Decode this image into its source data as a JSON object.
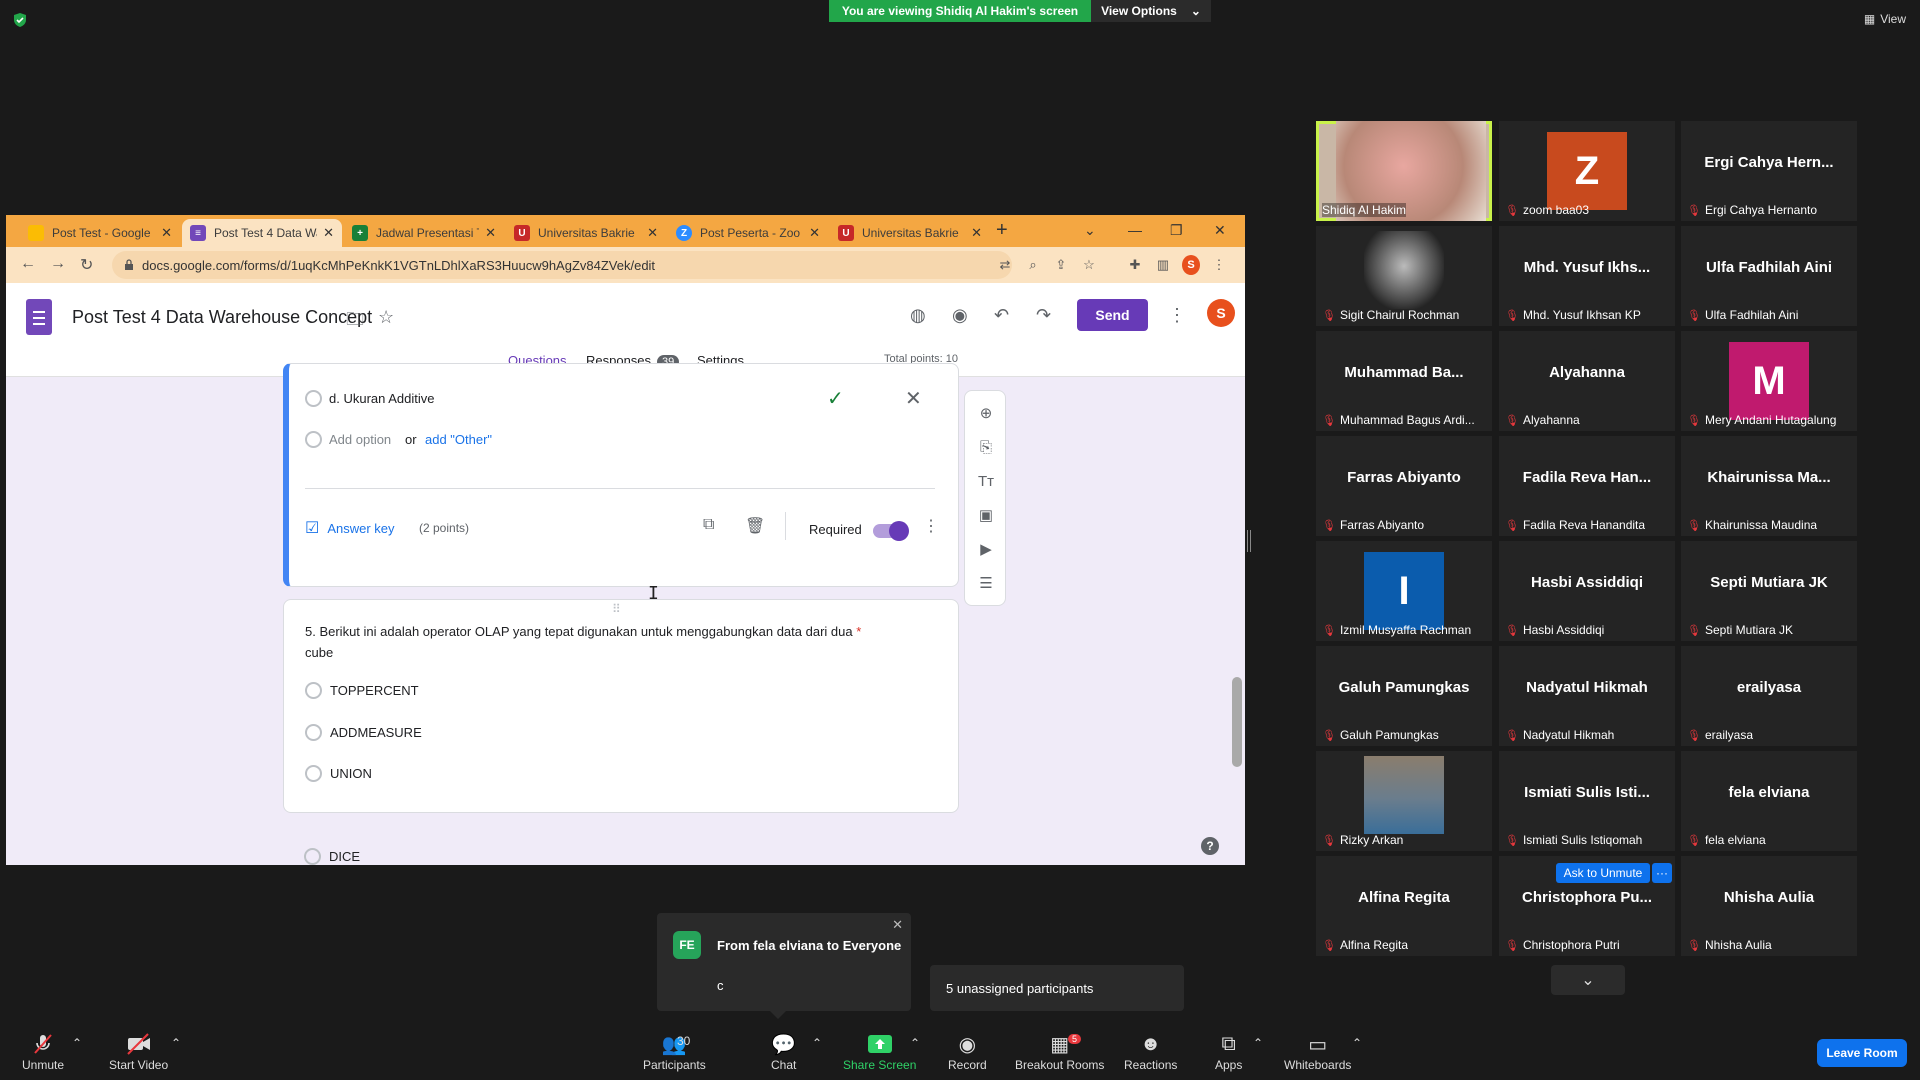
{
  "zoom": {
    "viewing_banner": "You are viewing Shidiq Al Hakim's screen",
    "view_options": "View Options",
    "view_label": "View"
  },
  "browser": {
    "tabs": [
      {
        "label": "Post Test - Google",
        "color": "#4285f4",
        "icon": "drive-icon"
      },
      {
        "label": "Post Test 4 Data Wa",
        "color": "#7248b9",
        "icon": "forms-icon"
      },
      {
        "label": "Jadwal Presentasi T",
        "color": "#188038",
        "icon": "sheets-icon"
      },
      {
        "label": "Universitas Bakrie",
        "color": "#c62828",
        "icon": "shield-icon"
      },
      {
        "label": "Post Peserta - Zoo",
        "color": "#2d8cff",
        "icon": "zoom-icon"
      },
      {
        "label": "Universitas Bakrie",
        "color": "#c62828",
        "icon": "shield-icon"
      }
    ],
    "url": "docs.google.com/forms/d/1uqKcMhPeKnkK1VGTnLDhlXaRS3Huucw9hAgZv84ZVek/edit",
    "profile_initial": "S"
  },
  "forms": {
    "title": "Post Test 4 Data Warehouse Concept",
    "send": "Send",
    "avatar_initial": "S",
    "tabs": {
      "questions": "Questions",
      "responses": "Responses",
      "responses_count": "39",
      "settings": "Settings"
    },
    "total_points": "Total points: 10",
    "q4": {
      "option_d": "d. Ukuran Additive",
      "add_option": "Add option",
      "or": "or",
      "add_other": "add \"Other\"",
      "answer_key": "Answer key",
      "points": "(2 points)",
      "required": "Required"
    },
    "q5": {
      "title": "5. Berikut ini adalah operator OLAP yang tepat digunakan untuk menggabungkan data dari dua",
      "title_line2": "cube",
      "asterisk": "*",
      "options": [
        "TOPPERCENT",
        "ADDMEASURE",
        "UNION",
        "DICE"
      ]
    },
    "help": "?"
  },
  "gallery": {
    "tiles": [
      {
        "name": "",
        "label": "Shidiq Al Hakim",
        "letter": "",
        "bg": "",
        "photo": "video"
      },
      {
        "name": "",
        "label": "zoom baa03",
        "letter": "Z",
        "bg": "#c84a1e",
        "photo": ""
      },
      {
        "name": "Ergi Cahya Hern...",
        "label": "Ergi Cahya Hernanto",
        "letter": "",
        "bg": "",
        "photo": ""
      },
      {
        "name": "",
        "label": "Sigit Chairul Rochman",
        "letter": "",
        "bg": "",
        "photo": "sketch"
      },
      {
        "name": "Mhd. Yusuf Ikhs...",
        "label": "Mhd. Yusuf Ikhsan KP",
        "letter": "",
        "bg": "",
        "photo": ""
      },
      {
        "name": "Ulfa Fadhilah Aini",
        "label": "Ulfa Fadhilah Aini",
        "letter": "",
        "bg": "",
        "photo": ""
      },
      {
        "name": "Muhammad Ba...",
        "label": "Muhammad Bagus Ardi...",
        "letter": "",
        "bg": "",
        "photo": ""
      },
      {
        "name": "Alyahanna",
        "label": "Alyahanna",
        "letter": "",
        "bg": "",
        "photo": ""
      },
      {
        "name": "",
        "label": "Mery Andani Hutagalung",
        "letter": "M",
        "bg": "#c01a6e",
        "photo": ""
      },
      {
        "name": "Farras Abiyanto",
        "label": "Farras Abiyanto",
        "letter": "",
        "bg": "",
        "photo": ""
      },
      {
        "name": "Fadila Reva Han...",
        "label": "Fadila Reva Hanandita",
        "letter": "",
        "bg": "",
        "photo": ""
      },
      {
        "name": "Khairunissa Ma...",
        "label": "Khairunissa Maudina",
        "letter": "",
        "bg": "",
        "photo": ""
      },
      {
        "name": "",
        "label": "Izmil Musyaffa Rachman",
        "letter": "I",
        "bg": "#0b5cad",
        "photo": ""
      },
      {
        "name": "Hasbi Assiddiqi",
        "label": "Hasbi Assiddiqi",
        "letter": "",
        "bg": "",
        "photo": ""
      },
      {
        "name": "Septi Mutiara JK",
        "label": "Septi Mutiara JK",
        "letter": "",
        "bg": "",
        "photo": ""
      },
      {
        "name": "Galuh Pamungkas",
        "label": "Galuh Pamungkas",
        "letter": "",
        "bg": "",
        "photo": ""
      },
      {
        "name": "Nadyatul Hikmah",
        "label": "Nadyatul Hikmah",
        "letter": "",
        "bg": "",
        "photo": ""
      },
      {
        "name": "erailyasa",
        "label": "erailyasa",
        "letter": "",
        "bg": "",
        "photo": ""
      },
      {
        "name": "",
        "label": "Rizky Arkan",
        "letter": "",
        "bg": "",
        "photo": "person"
      },
      {
        "name": "Ismiati Sulis Isti...",
        "label": "Ismiati Sulis Istiqomah",
        "letter": "",
        "bg": "",
        "photo": ""
      },
      {
        "name": "fela elviana",
        "label": "fela elviana",
        "letter": "",
        "bg": "",
        "photo": ""
      },
      {
        "name": "Alfina Regita",
        "label": "Alfina Regita",
        "letter": "",
        "bg": "",
        "photo": ""
      },
      {
        "name": "Christophora Pu...",
        "label": "Christophora Putri",
        "letter": "",
        "bg": "",
        "photo": ""
      },
      {
        "name": "Nhisha Aulia",
        "label": "Nhisha Aulia",
        "letter": "",
        "bg": "",
        "photo": ""
      }
    ],
    "ask_to_unmute": "Ask to Unmute",
    "more": "···"
  },
  "chat": {
    "initials": "FE",
    "from": "From fela elviana to Everyone",
    "message": "c"
  },
  "unassigned": "5 unassigned participants",
  "toolbar": {
    "unmute": "Unmute",
    "start_video": "Start Video",
    "participants": "Participants",
    "participants_count": "30",
    "chat": "Chat",
    "share_screen": "Share Screen",
    "record": "Record",
    "breakout_rooms": "Breakout Rooms",
    "breakout_count": "5",
    "reactions": "Reactions",
    "apps": "Apps",
    "whiteboards": "Whiteboards",
    "leave_room": "Leave Room"
  },
  "colors": {
    "zoom_green": "#22a64a",
    "forms_purple": "#673ab7",
    "zoom_blue": "#0e72ed",
    "muted_red": "#e8383d"
  }
}
